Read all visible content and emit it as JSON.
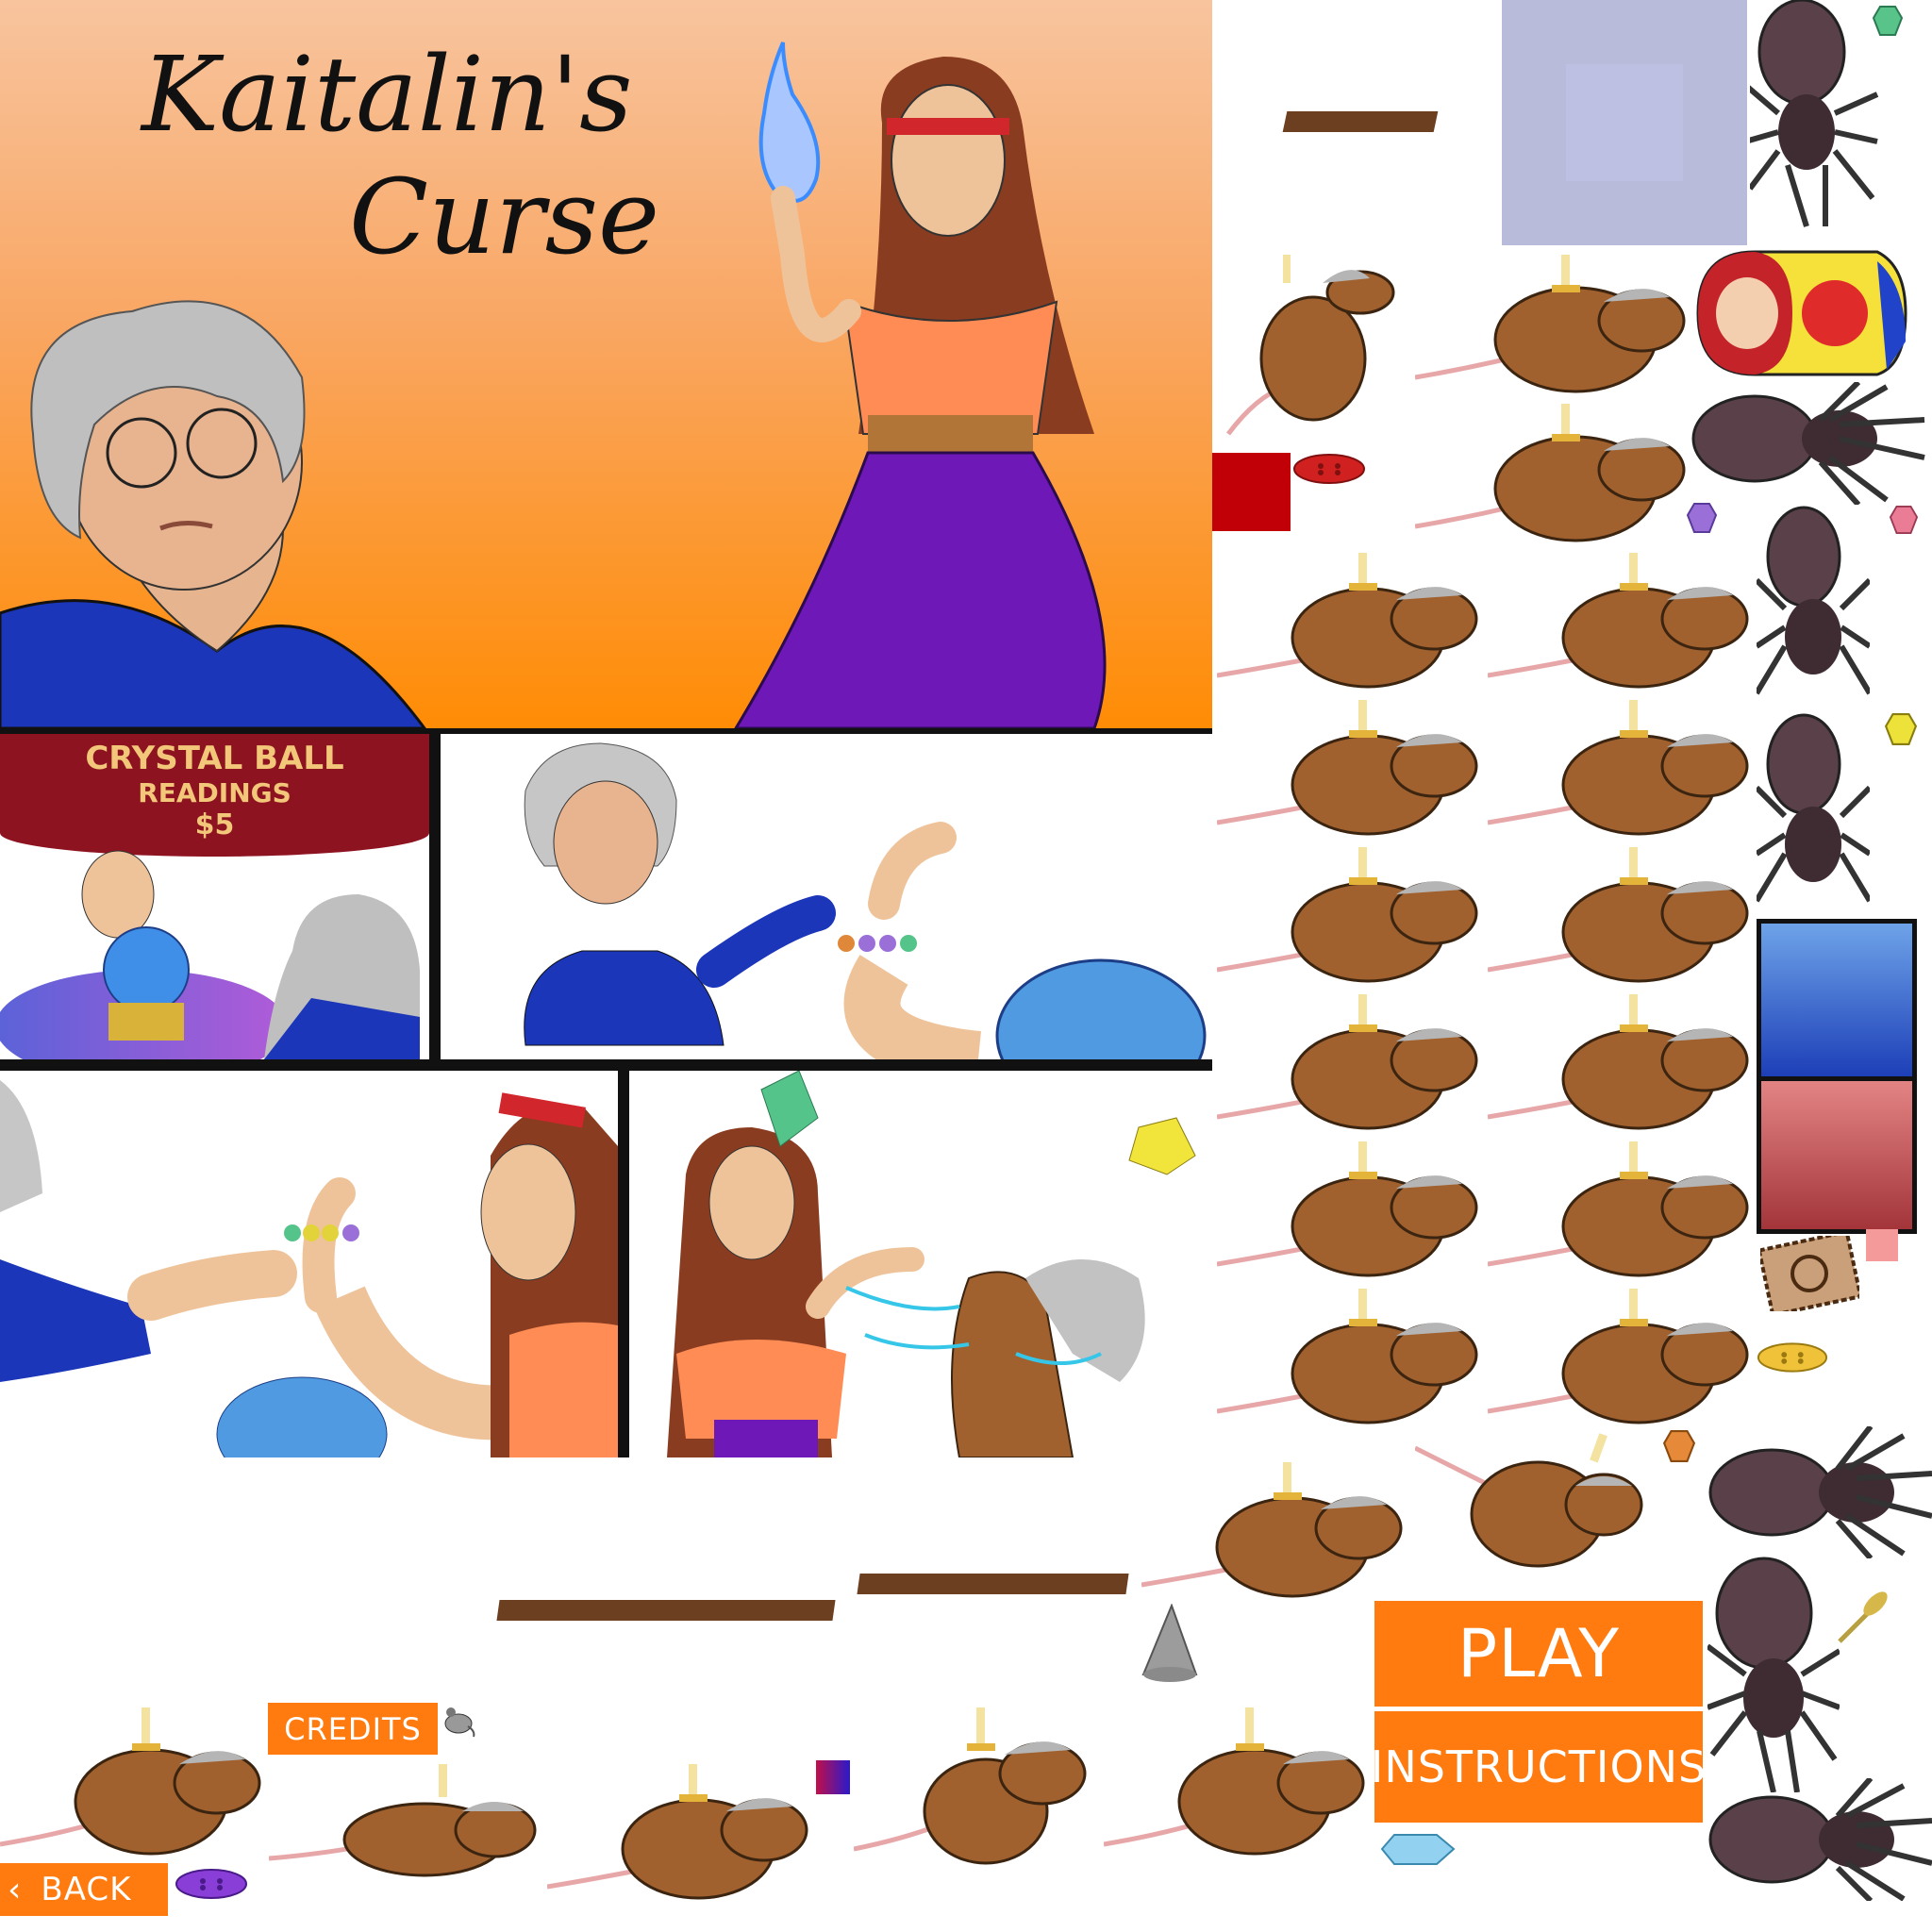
{
  "title": {
    "line1": "Kaitalin's",
    "line2": "Curse"
  },
  "comic": {
    "banner_line1": "CRYSTAL BALL",
    "banner_line2": "READINGS",
    "banner_price": "$5"
  },
  "buttons": {
    "play": "PLAY",
    "instructions": "INSTRUCTIONS",
    "credits": "CREDITS",
    "back": "BACK"
  },
  "icons": {
    "back": "chevron-left-icon",
    "candle_rat": "rat-with-candle-icon",
    "spider": "spider-icon",
    "gem": "gem-icon",
    "button_item": "sewing-button-icon",
    "matryoshka": "matryoshka-doll-icon",
    "shelf": "wooden-plank-icon",
    "stamp": "postage-stamp-icon",
    "spike": "cone-spike-icon",
    "pin": "thumbtack-icon"
  },
  "colors": {
    "orange_btn": "#ff7a0f",
    "banner": "#8e1320",
    "plank": "#6b3f1f",
    "rat": "#a0612f",
    "spider": "#4a363c",
    "lavender": "#b9bbdb",
    "blue_tile": "#4c82dc",
    "red_tile": "#c9504b"
  }
}
